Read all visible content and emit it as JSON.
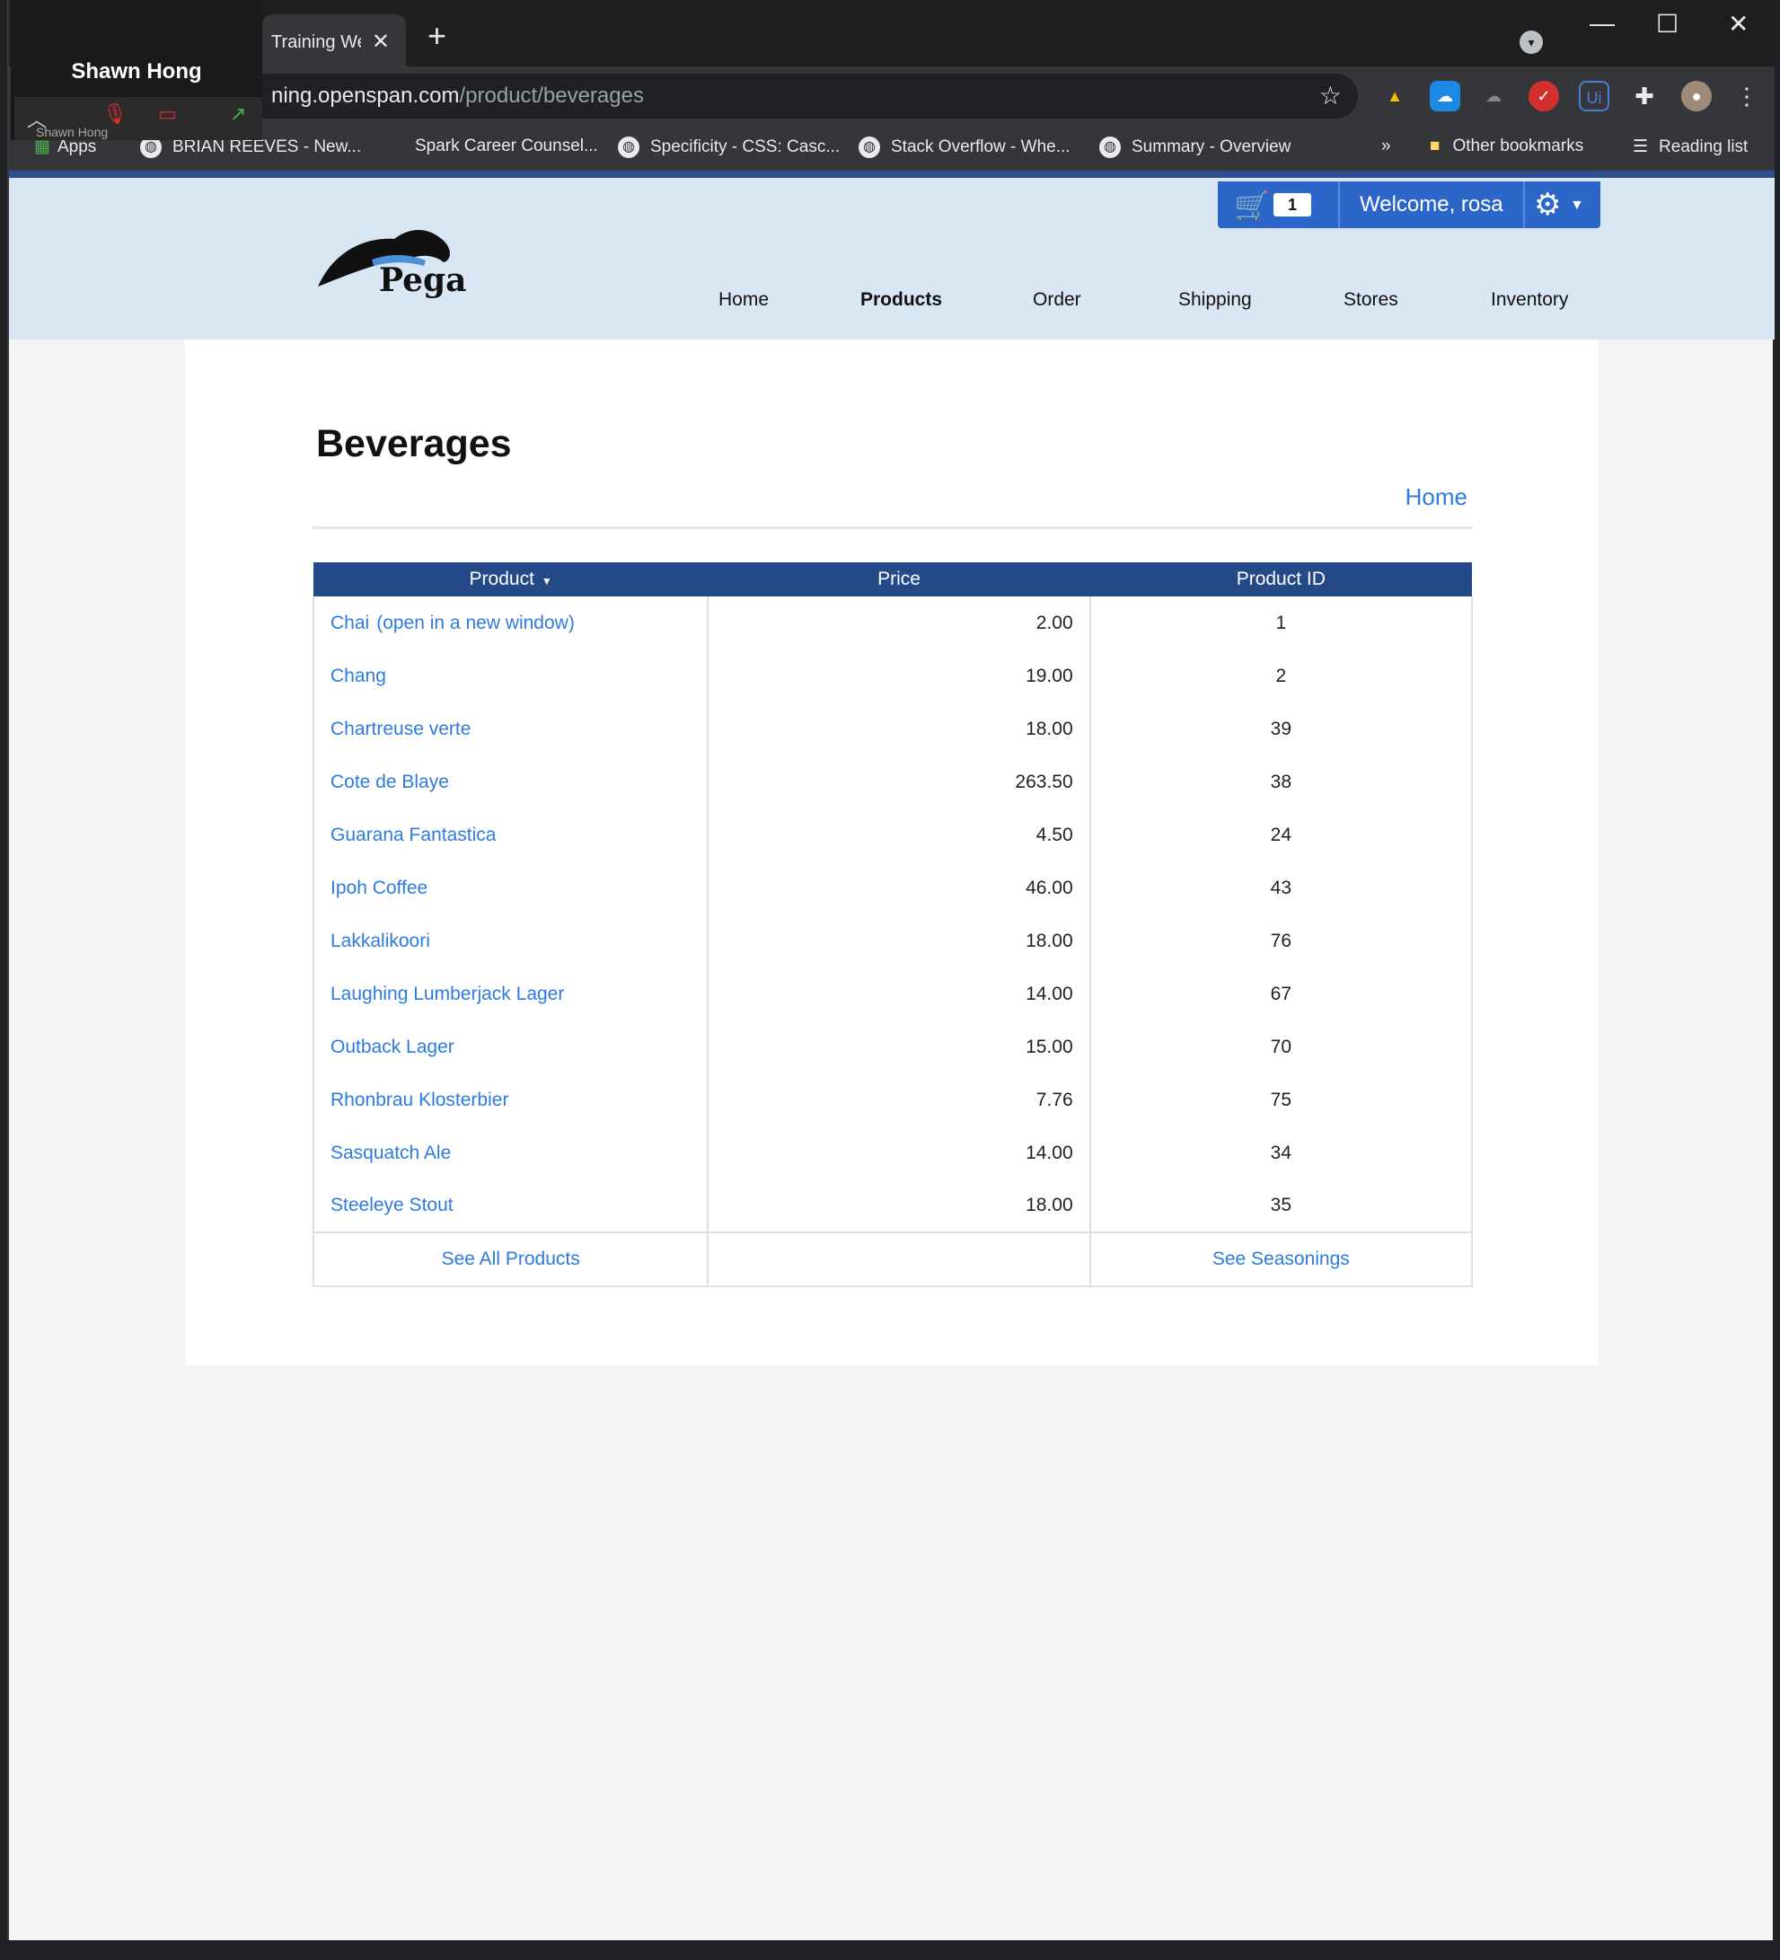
{
  "browser": {
    "tab_title": "Training We",
    "tab_close": "✕",
    "new_tab": "+",
    "url_host": "ning.openspan.com",
    "url_path": "/product/beverages",
    "window_controls": {
      "minimize": "—",
      "maximize": "☐",
      "close": "✕"
    },
    "bookmarks": {
      "apps": "Apps",
      "items": [
        "BRIAN REEVES - New...",
        "Spark Career Counsel...",
        "Specificity - CSS: Casc...",
        "Stack Overflow - Whe...",
        "Summary - Overview"
      ],
      "more": "»",
      "other": "Other bookmarks",
      "reading": "Reading list"
    }
  },
  "zoom": {
    "name": "Shawn Hong",
    "small_name": "Shawn Hong"
  },
  "header": {
    "logo_text": "Pega",
    "cart_count": "1",
    "welcome": "Welcome, rosa",
    "nav": [
      "Home",
      "Products",
      "Order",
      "Shipping",
      "Stores",
      "Inventory"
    ],
    "active_nav": "Products"
  },
  "main": {
    "title": "Beverages",
    "home_link": "Home",
    "table": {
      "headers": [
        "Product",
        "Price",
        "Product ID"
      ],
      "sort_indicator": "▼",
      "rows": [
        {
          "product": "Chai",
          "note": "(open in a new window)",
          "price": "2.00",
          "id": "1"
        },
        {
          "product": "Chang",
          "note": "",
          "price": "19.00",
          "id": "2"
        },
        {
          "product": "Chartreuse verte",
          "note": "",
          "price": "18.00",
          "id": "39"
        },
        {
          "product": "Cote de Blaye",
          "note": "",
          "price": "263.50",
          "id": "38"
        },
        {
          "product": "Guarana Fantastica",
          "note": "",
          "price": "4.50",
          "id": "24"
        },
        {
          "product": "Ipoh Coffee",
          "note": "",
          "price": "46.00",
          "id": "43"
        },
        {
          "product": "Lakkalikoori",
          "note": "",
          "price": "18.00",
          "id": "76"
        },
        {
          "product": "Laughing Lumberjack Lager",
          "note": "",
          "price": "14.00",
          "id": "67"
        },
        {
          "product": "Outback Lager",
          "note": "",
          "price": "15.00",
          "id": "70"
        },
        {
          "product": "Rhonbrau Klosterbier",
          "note": "",
          "price": "7.76",
          "id": "75"
        },
        {
          "product": "Sasquatch Ale",
          "note": "",
          "price": "14.00",
          "id": "34"
        },
        {
          "product": "Steeleye Stout",
          "note": "",
          "price": "18.00",
          "id": "35"
        }
      ],
      "footer_left": "See All Products",
      "footer_right": "See Seasonings"
    }
  },
  "colors": {
    "header_bg": "#d9e6f4",
    "table_header": "#244989",
    "link": "#2d7be0",
    "utility_bar": "#2d66c9"
  }
}
